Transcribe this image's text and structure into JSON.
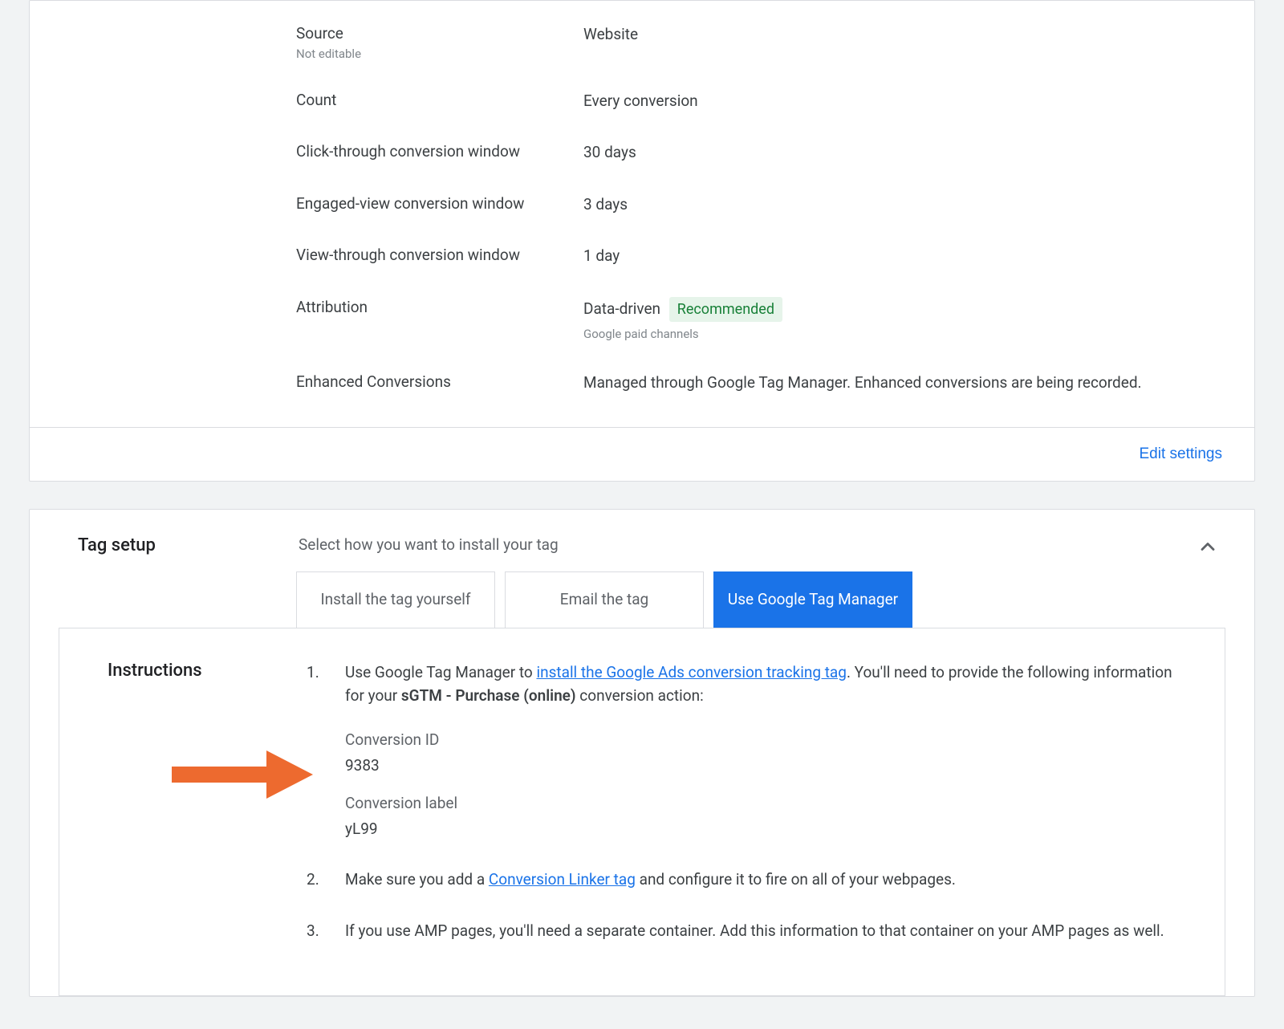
{
  "settings": {
    "rows": [
      {
        "label": "Source",
        "sublabel": "Not editable",
        "value": "Website",
        "valueSub": "",
        "badge": ""
      },
      {
        "label": "Count",
        "sublabel": "",
        "value": "Every conversion",
        "valueSub": "",
        "badge": ""
      },
      {
        "label": "Click-through conversion window",
        "sublabel": "",
        "value": "30 days",
        "valueSub": "",
        "badge": ""
      },
      {
        "label": "Engaged-view conversion window",
        "sublabel": "",
        "value": "3 days",
        "valueSub": "",
        "badge": ""
      },
      {
        "label": "View-through conversion window",
        "sublabel": "",
        "value": "1 day",
        "valueSub": "",
        "badge": ""
      },
      {
        "label": "Attribution",
        "sublabel": "",
        "value": "Data-driven",
        "valueSub": "Google paid channels",
        "badge": "Recommended"
      },
      {
        "label": "Enhanced Conversions",
        "sublabel": "",
        "value": "Managed through Google Tag Manager. Enhanced conversions are being recorded.",
        "valueSub": "",
        "badge": ""
      }
    ],
    "editLabel": "Edit settings"
  },
  "tagSetup": {
    "title": "Tag setup",
    "subtitle": "Select how you want to install your tag",
    "tabs": [
      {
        "label": "Install the tag yourself",
        "active": false
      },
      {
        "label": "Email the tag",
        "active": false
      },
      {
        "label": "Use Google Tag Manager",
        "active": true
      }
    ]
  },
  "instructions": {
    "title": "Instructions",
    "step1": {
      "pre": "Use Google Tag Manager to ",
      "link": "install the Google Ads conversion tracking tag",
      "mid": ". You'll need to provide the following information for your ",
      "bold": "sGTM - Purchase (online)",
      "post": " conversion action:",
      "conversionIdLabel": "Conversion ID",
      "conversionIdValue": "9383",
      "conversionLabelLabel": "Conversion label",
      "conversionLabelValue": "yL99"
    },
    "step2": {
      "pre": "Make sure you add a ",
      "link": "Conversion Linker tag",
      "post": " and configure it to fire on all of your webpages."
    },
    "step3": "If you use AMP pages, you'll need a separate container. Add this information to that container on your AMP pages as well."
  }
}
